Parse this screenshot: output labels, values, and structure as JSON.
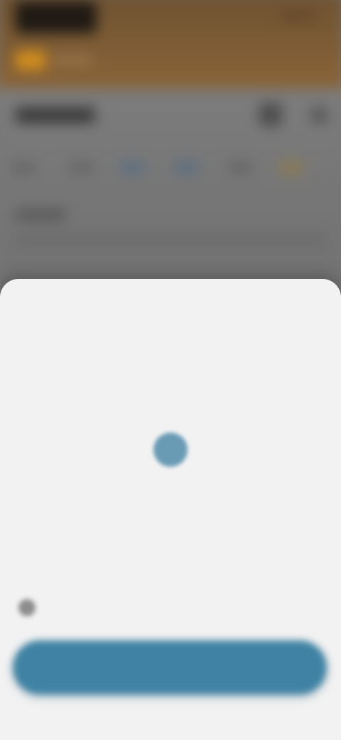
{
  "colors": {
    "header_brown": "#7a5a35",
    "badge_orange": "#d48f1c",
    "overlay_gray": "#777777",
    "sheet_bg": "#f2f2f2",
    "accent_blue": "#3f82a3",
    "selected_day": "#6a9bb5"
  },
  "calendar": {
    "month_title": "",
    "weekdays": [
      "",
      "",
      "",
      "",
      "",
      "",
      ""
    ],
    "selected_day_index": 17
  },
  "confirm_button": {
    "label": ""
  },
  "icons": {
    "timezone": "globe-icon"
  }
}
